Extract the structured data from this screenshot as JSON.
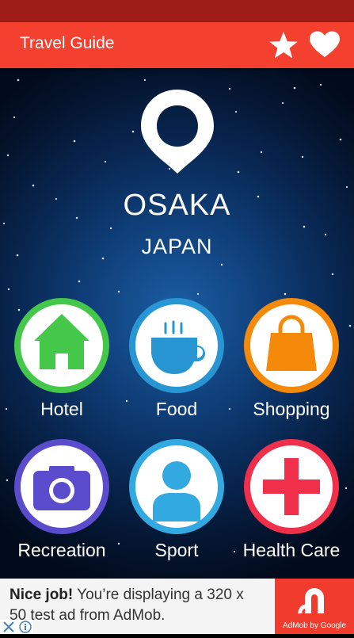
{
  "app_bar": {
    "title": "Travel Guide",
    "icons": [
      "star-icon",
      "heart-icon"
    ],
    "background": "#f3402f"
  },
  "destination": {
    "icon": "location-pin-icon",
    "city": "OSAKA",
    "country": "JAPAN"
  },
  "categories": [
    {
      "label": "Hotel",
      "icon": "house-icon",
      "color": "#45c84a"
    },
    {
      "label": "Food",
      "icon": "coffee-cup-icon",
      "color": "#2996d4"
    },
    {
      "label": "Shopping",
      "icon": "shopping-bag-icon",
      "color": "#f58a0a"
    },
    {
      "label": "Recreation",
      "icon": "camera-icon",
      "color": "#5a4ccc"
    },
    {
      "label": "Sport",
      "icon": "person-icon",
      "color": "#32a9e0"
    },
    {
      "label": "Health Care",
      "icon": "medical-cross-icon",
      "color": "#f0304a"
    }
  ],
  "ad_banner": {
    "headline": "Nice job!",
    "body": "You’re displaying a 320 x 50 test ad from AdMob.",
    "caption": "AdMob by Google",
    "brand_color": "#f13c2d"
  }
}
